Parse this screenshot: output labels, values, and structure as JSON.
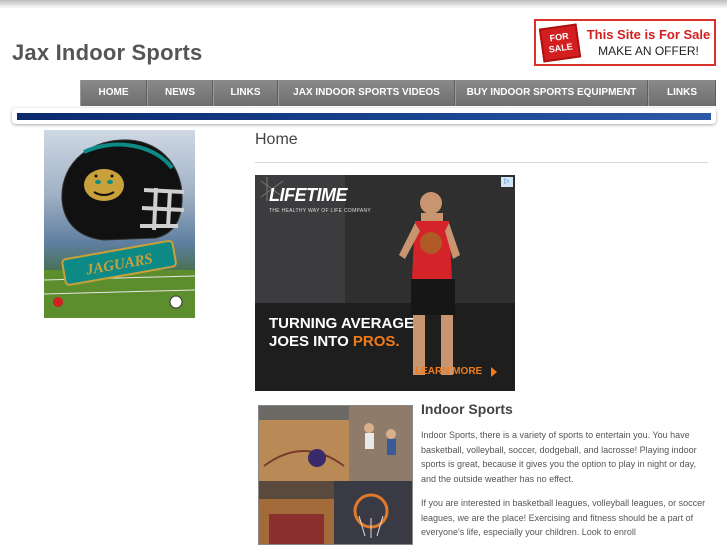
{
  "header": {
    "site_title": "Jax Indoor Sports"
  },
  "sale_banner": {
    "sign_top": "FOR",
    "sign_bottom": "SALE",
    "line1": "This Site is For Sale",
    "line2": "MAKE AN OFFER!",
    "color": "#d31f1f"
  },
  "nav": {
    "items": [
      {
        "label": "HOME"
      },
      {
        "label": "NEWS"
      },
      {
        "label": "LINKS"
      },
      {
        "label": "JAX INDOOR SPORTS VIDEOS"
      },
      {
        "label": "BUY INDOOR SPORTS EQUIPMENT"
      },
      {
        "label": "LINKS"
      }
    ]
  },
  "sidebar": {
    "logo_text": "JAGUARS"
  },
  "main": {
    "page_heading": "Home",
    "ad": {
      "brand": "LIFETIME",
      "tagline": "THE HEALTHY WAY OF LIFE COMPANY",
      "headline_line1": "TURNING AVERAGE",
      "headline_line2_prefix": "JOES INTO ",
      "headline_line2_accent": "PROS.",
      "cta": "LEARN MORE",
      "accent_color": "#f07b1c"
    },
    "section_title": "Indoor Sports",
    "paragraph1": "Indoor Sports, there is a variety of sports to entertain you. You have basketball, volleyball, soccer, dodgeball, and lacrosse! Playing indoor sports is great, because it gives you the option to play in night or day, and the outside weather has no effect.",
    "paragraph2": "If you are interested in basketball leagues, volleyball leagues, or soccer leagues, we are the place! Exercising and fitness should be a part of everyone's life, especially your children. Look to enroll"
  }
}
